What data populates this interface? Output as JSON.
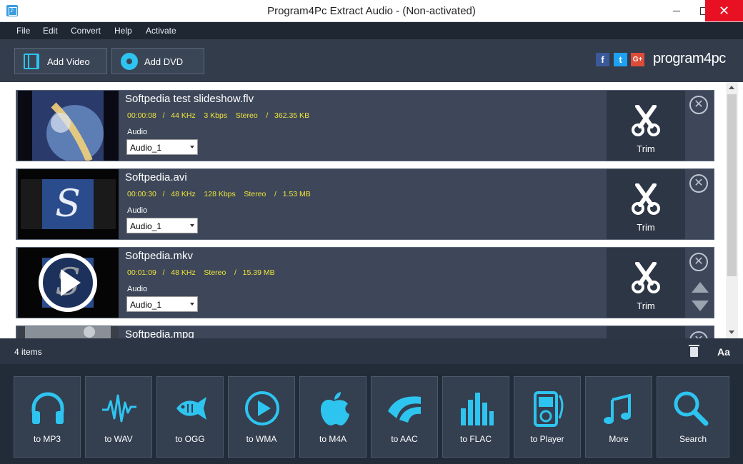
{
  "window": {
    "title": "Program4Pc Extract Audio - (Non-activated)",
    "close_glyph": "✕"
  },
  "menu": [
    "File",
    "Edit",
    "Convert",
    "Help",
    "Activate"
  ],
  "toolbar": {
    "add_video": "Add Video",
    "add_dvd": "Add DVD",
    "social": [
      "f",
      "t",
      "G+"
    ],
    "brand": "program4pc"
  },
  "files": [
    {
      "name": "Softpedia test slideshow.flv",
      "meta": "00:00:08   /   44 KHz    3 Kbps    Stereo    /   362.35 KB",
      "audio_label": "Audio",
      "audio_value": "Audio_1",
      "trim_label": "Trim"
    },
    {
      "name": "Softpedia.avi",
      "meta": "00:00:30   /   48 KHz    128 Kbps    Stereo    /   1.53 MB",
      "audio_label": "Audio",
      "audio_value": "Audio_1",
      "trim_label": "Trim"
    },
    {
      "name": "Softpedia.mkv",
      "meta": "00:01:09   /   48 KHz    Stereo    /   15.39 MB",
      "audio_label": "Audio",
      "audio_value": "Audio_1",
      "trim_label": "Trim"
    },
    {
      "name": "Softpedia.mpg"
    }
  ],
  "status": {
    "items_count": "4  items",
    "font_toggle": "Aa"
  },
  "formats": [
    {
      "label": "to MP3",
      "icon": "headphones-icon"
    },
    {
      "label": "to WAV",
      "icon": "waveform-icon"
    },
    {
      "label": "to OGG",
      "icon": "fish-icon"
    },
    {
      "label": "to WMA",
      "icon": "play-circle-icon"
    },
    {
      "label": "to M4A",
      "icon": "apple-icon"
    },
    {
      "label": "to AAC",
      "icon": "aac-swoosh-icon"
    },
    {
      "label": "to FLAC",
      "icon": "equalizer-icon"
    },
    {
      "label": "to Player",
      "icon": "media-player-icon"
    },
    {
      "label": "More",
      "icon": "music-notes-icon"
    },
    {
      "label": "Search",
      "icon": "search-icon"
    }
  ],
  "colors": {
    "accent": "#2ec4f0",
    "meta_text": "#f0e33a",
    "row_bg": "#3d4759",
    "close_button": "#e81123"
  }
}
